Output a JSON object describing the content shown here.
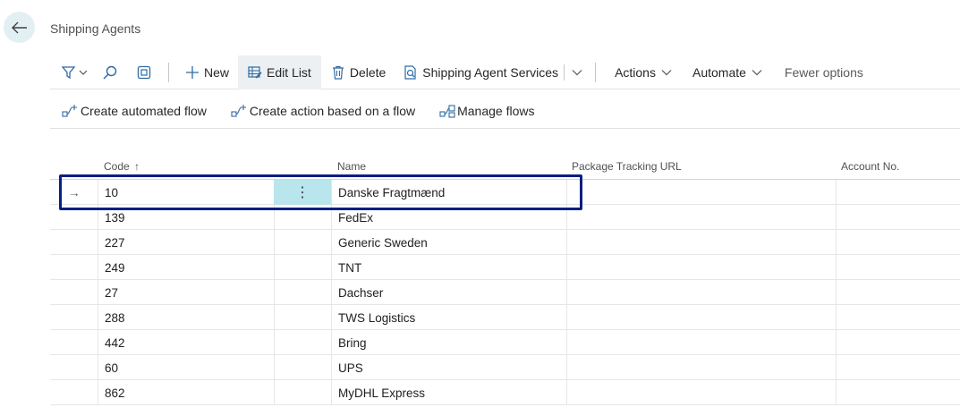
{
  "header": {
    "title": "Shipping Agents"
  },
  "toolbar": {
    "new_label": "New",
    "edit_list_label": "Edit List",
    "delete_label": "Delete",
    "services_label": "Shipping Agent Services",
    "actions_label": "Actions",
    "automate_label": "Automate",
    "fewer_options_label": "Fewer options"
  },
  "flowbar": {
    "create_flow_label": "Create automated flow",
    "action_flow_label": "Create action based on a flow",
    "manage_flows_label": "Manage flows"
  },
  "grid": {
    "columns": {
      "code": "Code",
      "code_sort": "↑",
      "name": "Name",
      "tracking_url": "Package Tracking URL",
      "account_no": "Account No."
    },
    "rows": [
      {
        "code": "10",
        "name": "Danske Fragtmænd"
      },
      {
        "code": "139",
        "name": "FedEx"
      },
      {
        "code": "227",
        "name": "Generic Sweden"
      },
      {
        "code": "249",
        "name": "TNT"
      },
      {
        "code": "27",
        "name": "Dachser"
      },
      {
        "code": "288",
        "name": "TWS Logistics"
      },
      {
        "code": "442",
        "name": "Bring"
      },
      {
        "code": "60",
        "name": "UPS"
      },
      {
        "code": "862",
        "name": "MyDHL Express"
      }
    ]
  },
  "icons": {
    "row_arrow": "→",
    "more": "⋮"
  },
  "colors": {
    "accent": "#0b1f82",
    "selected_cell": "#b8e6ec",
    "back_button_bg": "#e3f0f3"
  }
}
